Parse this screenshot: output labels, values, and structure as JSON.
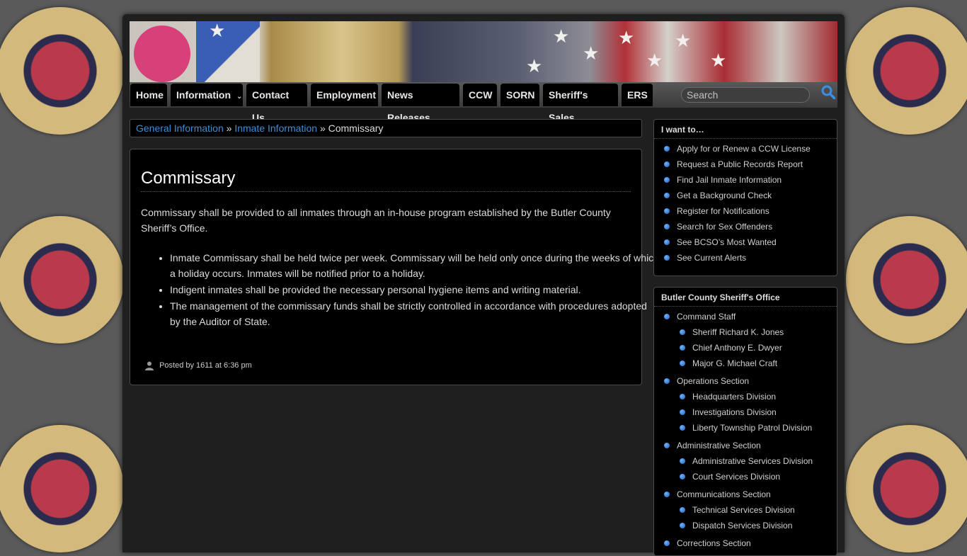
{
  "nav": {
    "items": [
      "Home",
      "Information",
      "Contact Us",
      "Employment",
      "News Releases",
      "CCW",
      "SORN",
      "Sheriff's Sales",
      "ERS"
    ],
    "search_placeholder": "Search"
  },
  "breadcrumb": {
    "crumb1": "General Information",
    "sep1": "»",
    "crumb2": "Inmate Information",
    "sep2": "»",
    "current": "Commissary"
  },
  "article": {
    "title": "Commissary",
    "intro": "Commissary shall be provided to all inmates through an in-house program established by the Butler County Sheriff’s Office.",
    "bullets": [
      "Inmate Commissary shall be held twice per week. Commissary will be held only once during the weeks of which a holiday occurs. Inmates will be notified prior to a holiday.",
      "Indigent inmates shall be provided the necessary personal hygiene items and writing material.",
      "The management of the commissary funds shall be strictly controlled in accordance with procedures adopted by the Auditor of State."
    ],
    "posted_by_label": "Posted by",
    "author": "1611",
    "at_label": "at",
    "time": "6:36 pm"
  },
  "sidebar": {
    "want_title": "I want to…",
    "want_items": [
      "Apply for or Renew a CCW License",
      "Request a Public Records Report",
      "Find Jail Inmate Information",
      "Get a Background Check",
      "Register for Notifications",
      "Search for Sex Offenders",
      "See BCSO’s Most Wanted",
      "See Current Alerts"
    ],
    "office_title": "Butler County Sheriff's Office",
    "office_items": [
      {
        "label": "Command Staff",
        "level": 0
      },
      {
        "label": "Sheriff Richard K. Jones",
        "level": 1
      },
      {
        "label": "Chief Anthony E. Dwyer",
        "level": 1
      },
      {
        "label": "Major G. Michael Craft",
        "level": 1
      },
      {
        "label": "Operations Section",
        "level": 0
      },
      {
        "label": "Headquarters Division",
        "level": 1
      },
      {
        "label": "Investigations Division",
        "level": 1
      },
      {
        "label": "Liberty Township Patrol Division",
        "level": 1
      },
      {
        "label": "Administrative Section",
        "level": 0
      },
      {
        "label": "Administrative Services Division",
        "level": 1
      },
      {
        "label": "Court Services Division",
        "level": 1
      },
      {
        "label": "Communications Section",
        "level": 0
      },
      {
        "label": "Technical Services Division",
        "level": 1
      },
      {
        "label": "Dispatch Services Division",
        "level": 1
      },
      {
        "label": "Corrections Section",
        "level": 0
      }
    ]
  },
  "colors": {
    "link": "#3d8fd8",
    "panel_bg": "#000000",
    "page_bg": "#1f1f1f"
  }
}
